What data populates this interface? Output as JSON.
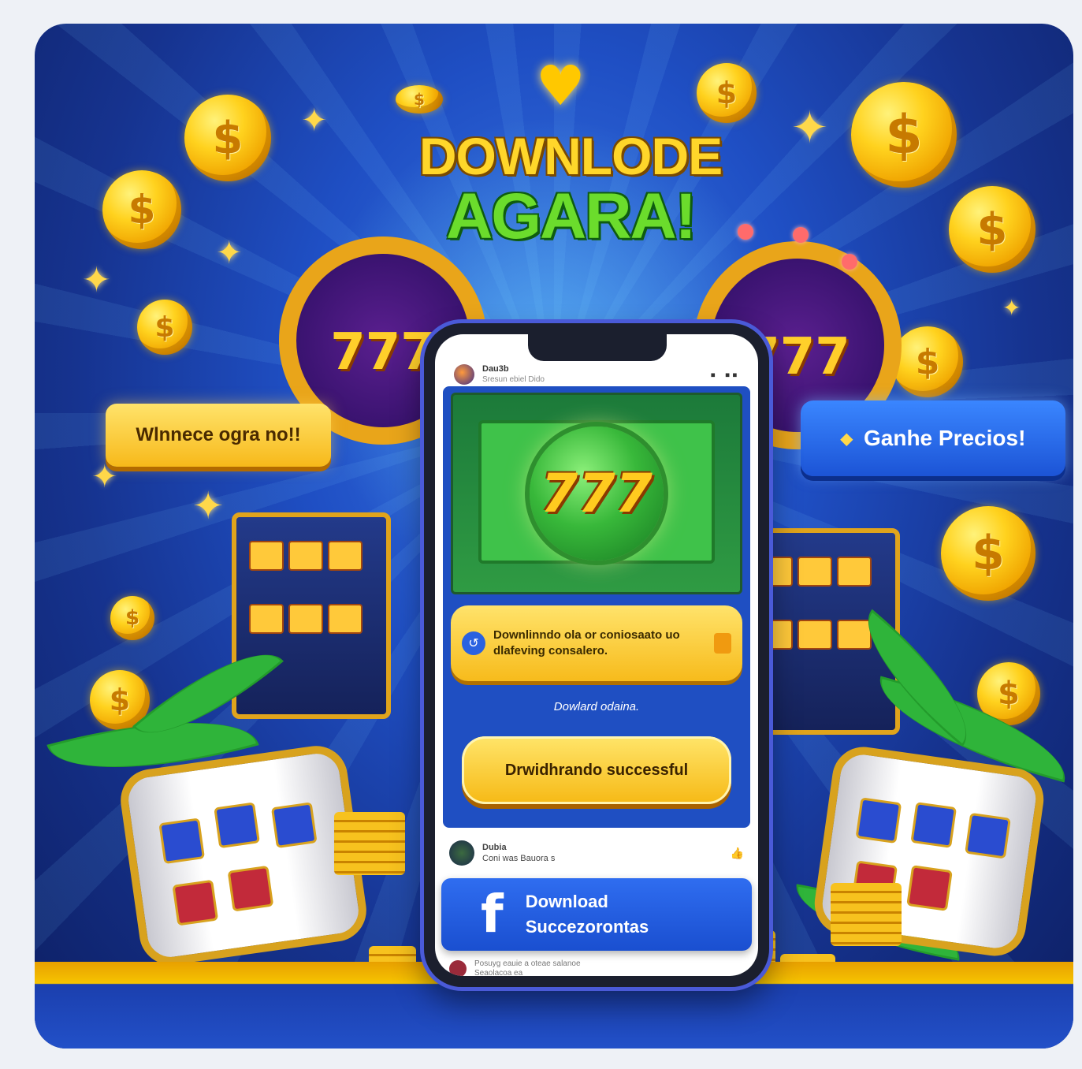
{
  "headline": {
    "line1": "DOWNLODE",
    "line2": "AGARA!"
  },
  "banners": {
    "left_text": "Wlnnece ogra no!!",
    "right_text": "Ganhe Precios!"
  },
  "decor": {
    "coin_symbol": "$",
    "slot_symbol": "777",
    "heart_glyph": "♥",
    "sparkle_glyph": "✦"
  },
  "phone": {
    "status": {
      "name": "Dau3b",
      "sub": "Sresun ebiel Dido",
      "icons": "▪ ▪▪"
    },
    "hero_label": "777",
    "notice": {
      "icon": "↺",
      "text": "Downlinndo ola or coniosaato uo dlafeving consalero."
    },
    "sub_label": "Dowlard odaina.",
    "cta_label": "Drwidhrando successful",
    "feed": {
      "name": "Dubia",
      "meta": "Coni was  Bauora s",
      "like_icon": "👍"
    },
    "fb_button": {
      "icon": "f",
      "line1": "Download",
      "line2": "Succezorontas"
    },
    "feed2": {
      "text": "Posuyg eauie a oteae salanoe",
      "sub": "Seaolacoa ea"
    }
  },
  "colors": {
    "background_deep": "#0d1f63",
    "background_mid": "#1f4fc4",
    "gold": "#ffd21e",
    "green_title": "#6bdc2c",
    "blue_button": "#1c54d6"
  }
}
